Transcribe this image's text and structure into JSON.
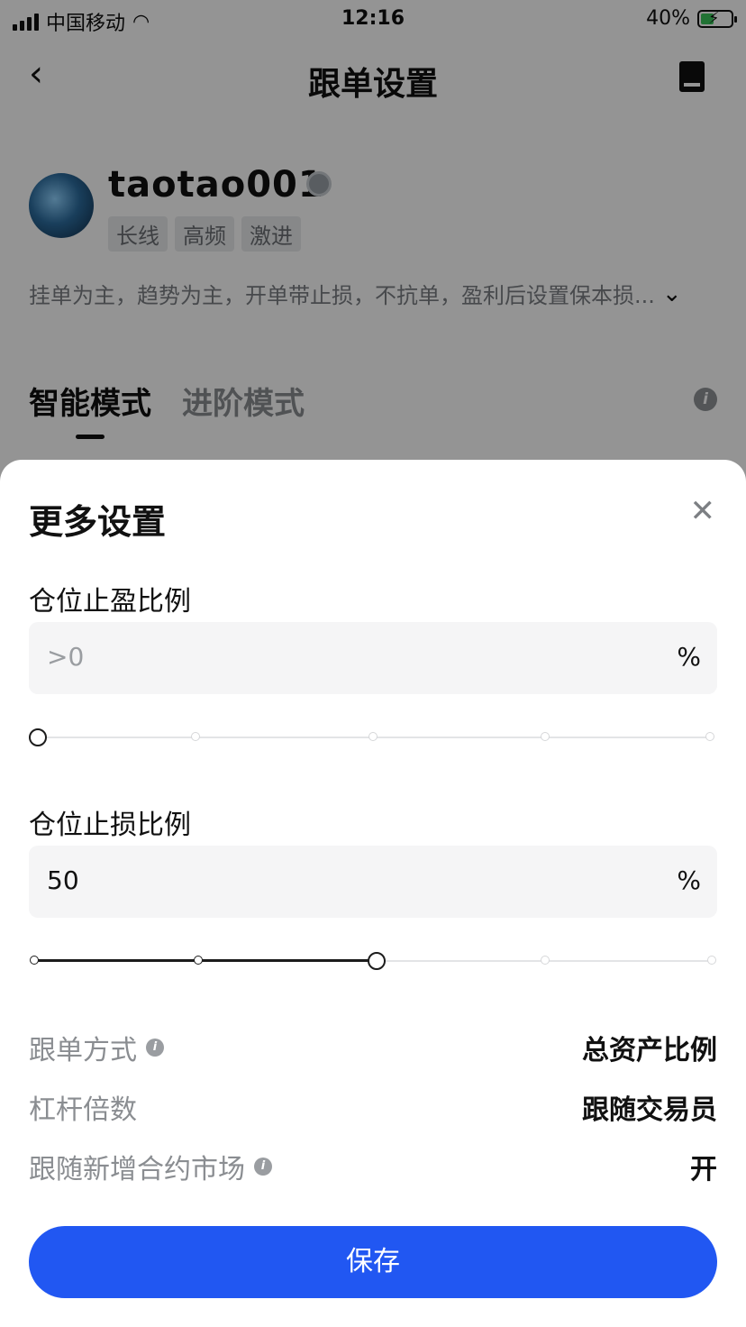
{
  "status_bar": {
    "carrier": "中国移动",
    "time": "12:16",
    "battery": "40%"
  },
  "nav": {
    "title": "跟单设置"
  },
  "trader": {
    "username": "taotao001",
    "tags": [
      "长线",
      "高频",
      "激进"
    ],
    "description": "挂单为主，趋势为主，开单带止损，不抗单，盈利后设置保本损..."
  },
  "modes": {
    "active": "智能模式",
    "inactive": "进阶模式"
  },
  "sheet": {
    "title": "更多设置",
    "take_profit": {
      "label": "仓位止盈比例",
      "placeholder": ">0",
      "unit": "%",
      "slider_value_pct": 0
    },
    "stop_loss": {
      "label": "仓位止损比例",
      "value": "50",
      "unit": "%",
      "slider_value_pct": 50
    },
    "rows": [
      {
        "label": "跟单方式",
        "value": "总资产比例"
      },
      {
        "label": "杠杆倍数",
        "value": "跟随交易员"
      },
      {
        "label": "跟随新增合约市场",
        "value": "开"
      }
    ],
    "save_label": "保存"
  },
  "colors": {
    "primary": "#2157f2",
    "overlay": "rgba(0,0,0,0.42)"
  },
  "icons": [
    "back-arrow-icon",
    "book-icon",
    "medal-icon",
    "chevron-down-icon",
    "info-icon",
    "close-icon",
    "wifi-icon",
    "battery-icon"
  ]
}
